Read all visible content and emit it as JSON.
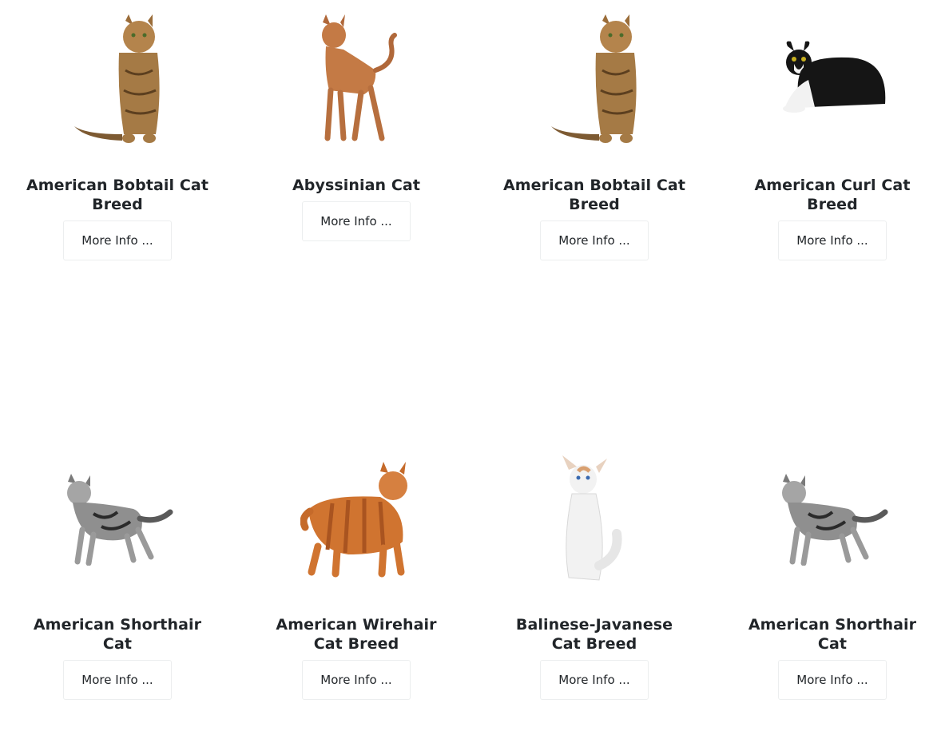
{
  "cards": [
    {
      "name": "American Bobtail Cat Breed",
      "button": "More Info ...",
      "icon": "tabby-cat-sitting-image"
    },
    {
      "name": "Abyssinian Cat",
      "button": "More Info ...",
      "icon": "ruddy-cat-standing-image"
    },
    {
      "name": "American Bobtail Cat Breed",
      "button": "More Info ...",
      "icon": "tabby-cat-sitting-image"
    },
    {
      "name": "American Curl Cat Breed",
      "button": "More Info ...",
      "icon": "black-white-cat-lying-image"
    },
    {
      "name": "American Shorthair Cat",
      "button": "More Info ...",
      "icon": "silver-tabby-cat-standing-image"
    },
    {
      "name": "American Wirehair Cat Breed",
      "button": "More Info ...",
      "icon": "orange-tabby-cat-standing-image"
    },
    {
      "name": "Balinese-Javanese Cat Breed",
      "button": "More Info ...",
      "icon": "white-cat-sitting-image"
    },
    {
      "name": "American Shorthair Cat",
      "button": "More Info ...",
      "icon": "silver-tabby-cat-standing-image"
    }
  ],
  "colors": {
    "tabby": "#a57a45",
    "ruddy": "#c47a45",
    "black": "#151515",
    "silver": "#8f8f8f",
    "orange": "#d07430",
    "white": "#f2f2f2",
    "button_border": "#eceeef",
    "text": "#212529"
  }
}
